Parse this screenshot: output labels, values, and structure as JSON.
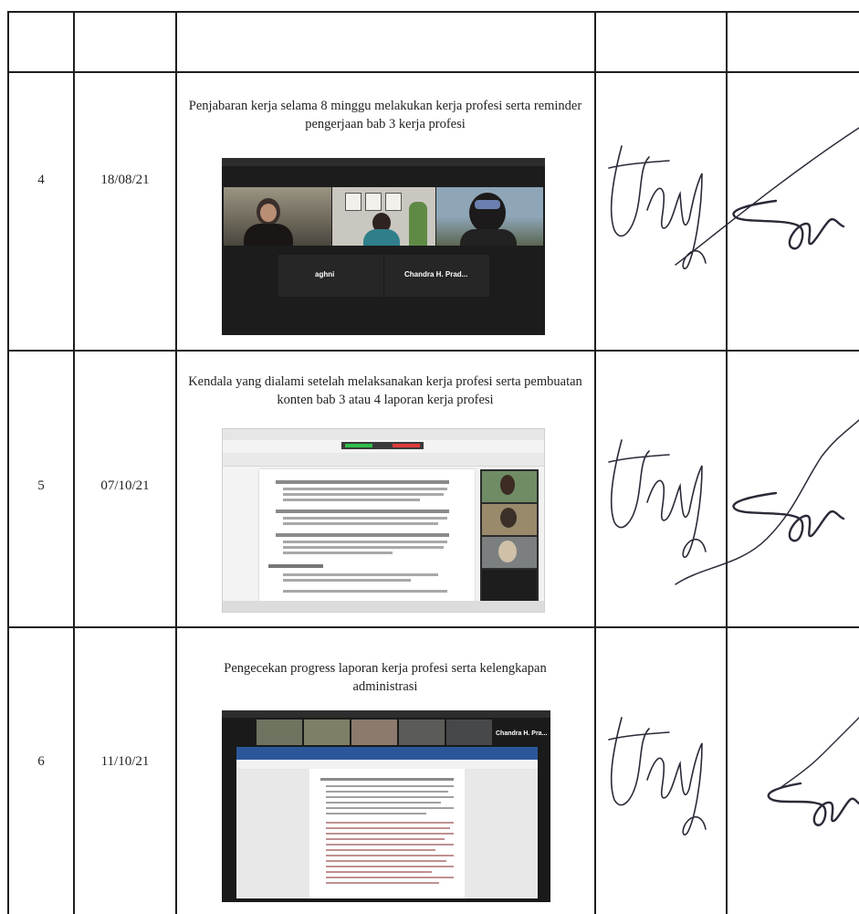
{
  "rows": [
    {
      "no": "4",
      "date": "18/08/21",
      "description": "Penjabaran kerja selama 8 minggu melakukan kerja profesi serta reminder pengerjaan bab 3 kerja profesi",
      "participants": [
        "aghni",
        "Chandra H. Prad..."
      ]
    },
    {
      "no": "5",
      "date": "07/10/21",
      "description": "Kendala yang dialami setelah melaksanakan kerja profesi serta pembuatan konten bab 3 atau 4 laporan kerja profesi"
    },
    {
      "no": "6",
      "date": "11/10/21",
      "description": "Pengecekan progress laporan kerja profesi serta kelengkapan administrasi",
      "participants": [
        "Chandra H. Pra..."
      ]
    }
  ],
  "colors": {
    "border": "#1e1e1e",
    "meeting_bg": "#1a1a1a",
    "word_blue": "#2b579a",
    "ink": "#2a2a38"
  }
}
